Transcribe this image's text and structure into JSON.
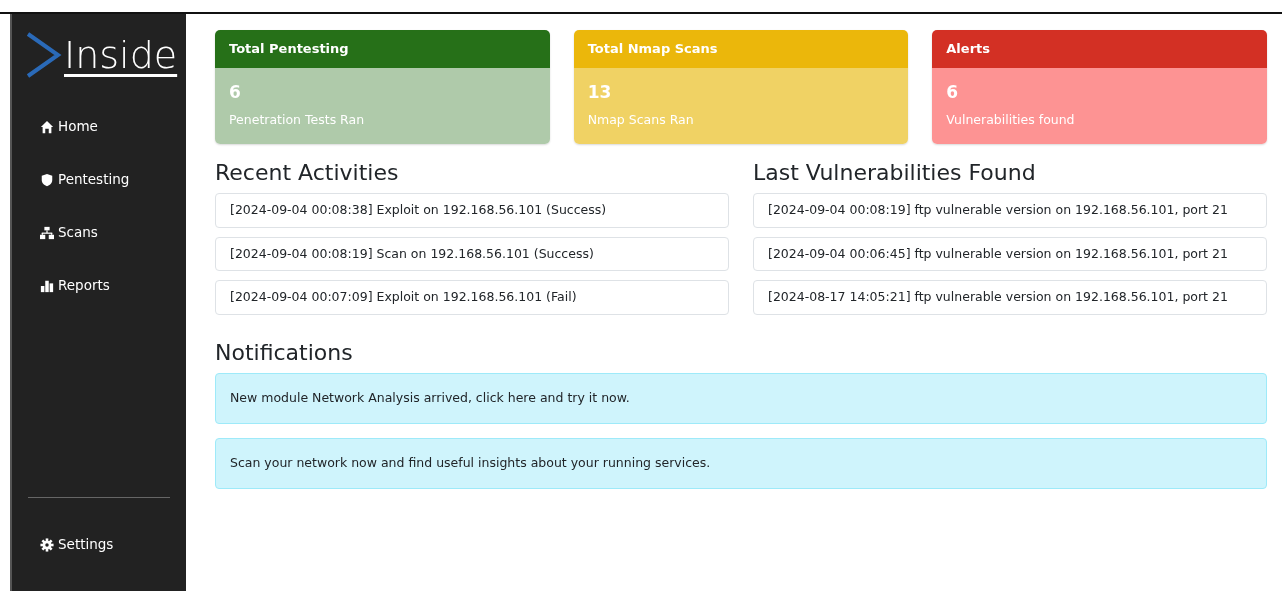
{
  "sidebar": {
    "logo": "Inside",
    "items": [
      {
        "label": "Home"
      },
      {
        "label": "Pentesting"
      },
      {
        "label": "Scans"
      },
      {
        "label": "Reports"
      }
    ],
    "footer_items": [
      {
        "label": "Settings"
      }
    ]
  },
  "stat_cards": [
    {
      "kind": "success",
      "title": "Total Pentesting",
      "count": "6",
      "caption": "Penetration Tests Ran"
    },
    {
      "kind": "warning",
      "title": "Total Nmap Scans",
      "count": "13",
      "caption": "Nmap Scans Ran"
    },
    {
      "kind": "danger",
      "title": "Alerts",
      "count": "6",
      "caption": "Vulnerabilities found"
    }
  ],
  "recent_activities": {
    "title": "Recent Activities",
    "items": [
      "[2024-09-04 00:08:38] Exploit on 192.168.56.101 (Success)",
      "[2024-09-04 00:08:19] Scan on 192.168.56.101 (Success)",
      "[2024-09-04 00:07:09] Exploit on 192.168.56.101 (Fail)"
    ]
  },
  "last_vulnerabilities": {
    "title": "Last Vulnerabilities Found",
    "items": [
      "[2024-09-04 00:08:19] ftp vulnerable version on 192.168.56.101, port 21",
      "[2024-09-04 00:06:45] ftp vulnerable version on 192.168.56.101, port 21",
      "[2024-08-17 14:05:21] ftp vulnerable version on 192.168.56.101, port 21"
    ]
  },
  "notifications": {
    "title": "Notifications",
    "items": [
      "New module Network Analysis arrived, click here and try it now.",
      "Scan your network now and find useful insights about your running services."
    ]
  }
}
